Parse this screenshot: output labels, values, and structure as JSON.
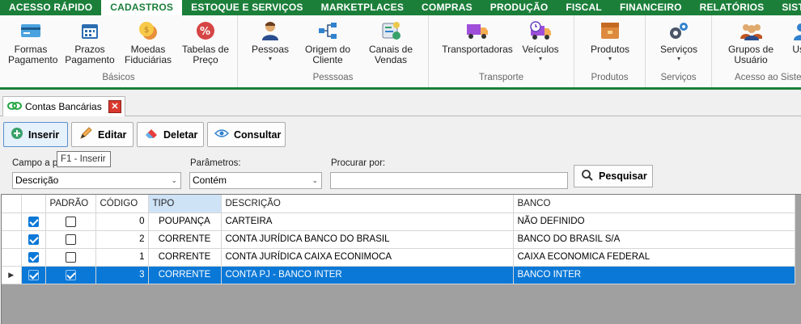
{
  "menu": [
    "ACESSO RÁPIDO",
    "CADASTROS",
    "ESTOQUE E SERVIÇOS",
    "MARKETPLACES",
    "COMPRAS",
    "PRODUÇÃO",
    "FISCAL",
    "FINANCEIRO",
    "RELATÓRIOS",
    "SISTEMA"
  ],
  "ribbon": {
    "basicos": {
      "label": "Básicos",
      "items": [
        {
          "l1": "Formas",
          "l2": "Pagamento"
        },
        {
          "l1": "Prazos",
          "l2": "Pagamento"
        },
        {
          "l1": "Moedas",
          "l2": "Fiduciárias"
        },
        {
          "l1": "Tabelas de",
          "l2": "Preço"
        }
      ]
    },
    "pessoas": {
      "label": "Pesssoas",
      "items": [
        {
          "l1": "Pessoas",
          "l2": "▾"
        },
        {
          "l1": "Origem do",
          "l2": "Cliente"
        },
        {
          "l1": "Canais de",
          "l2": "Vendas"
        }
      ]
    },
    "transporte": {
      "label": "Transporte",
      "items": [
        {
          "l1": "Transportadoras",
          "l2": ""
        },
        {
          "l1": "Veículos",
          "l2": "▾"
        }
      ]
    },
    "produtos": {
      "label": "Produtos",
      "items": [
        {
          "l1": "Produtos",
          "l2": "▾"
        }
      ]
    },
    "servicos": {
      "label": "Serviços",
      "items": [
        {
          "l1": "Serviços",
          "l2": "▾"
        }
      ]
    },
    "acesso": {
      "label": "Acesso ao Sistema",
      "items": [
        {
          "l1": "Grupos de",
          "l2": "Usuário"
        },
        {
          "l1": "Usu",
          "l2": ""
        }
      ]
    }
  },
  "tab": {
    "title": "Contas Bancárias",
    "close": "✕"
  },
  "toolbar": {
    "inserir": "Inserir",
    "editar": "Editar",
    "deletar": "Deletar",
    "consultar": "Consultar",
    "tooltip": "F1 - Inserir"
  },
  "filters": {
    "campo_label": "Campo a pr",
    "campo_value": "Descrição",
    "param_label": "Parâmetros:",
    "param_value": "Contém",
    "procurar_label": "Procurar por:",
    "procurar_value": "",
    "pesquisar": "Pesquisar"
  },
  "grid": {
    "headers": [
      "PADRÃO",
      "CÓDIGO",
      "TIPO",
      "DESCRIÇÃO",
      "BANCO"
    ],
    "rows": [
      {
        "ativo": true,
        "padrao": false,
        "codigo": "0",
        "tipo": "POUPANÇA",
        "descricao": "CARTEIRA",
        "banco": "NÃO DEFINIDO"
      },
      {
        "ativo": true,
        "padrao": false,
        "codigo": "2",
        "tipo": "CORRENTE",
        "descricao": "CONTA JURÍDICA BANCO DO BRASIL",
        "banco": "BANCO DO BRASIL S/A"
      },
      {
        "ativo": true,
        "padrao": false,
        "codigo": "1",
        "tipo": "CORRENTE",
        "descricao": "CONTA JURÍDICA CAIXA ECONIMOCA",
        "banco": "CAIXA ECONOMICA FEDERAL"
      },
      {
        "ativo": true,
        "padrao": true,
        "codigo": "3",
        "tipo": "CORRENTE",
        "descricao": "CONTA PJ - BANCO INTER",
        "banco": "BANCO INTER"
      }
    ],
    "selected_row": 3
  },
  "colors": {
    "brand": "#1b7f3a",
    "selection": "#0a78d7"
  }
}
